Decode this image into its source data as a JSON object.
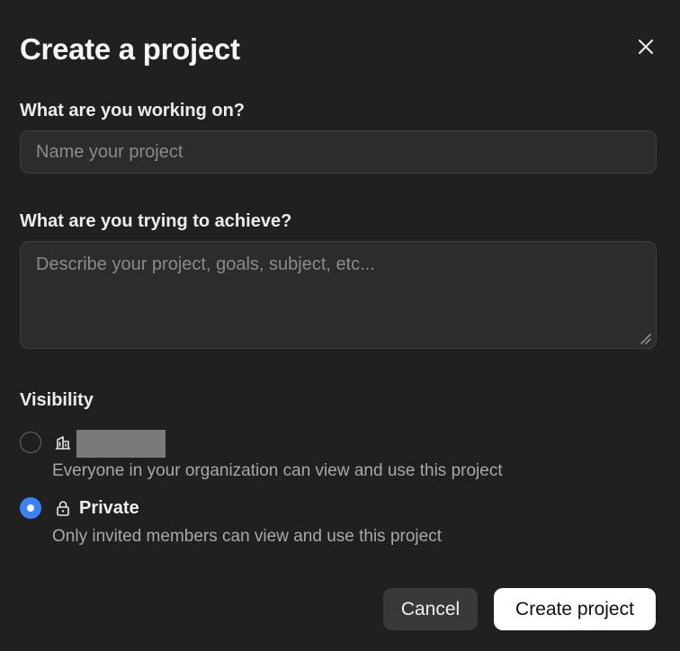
{
  "dialog": {
    "title": "Create a project",
    "close_icon": "close-icon"
  },
  "form": {
    "name": {
      "label": "What are you working on?",
      "placeholder": "Name your project",
      "value": ""
    },
    "goal": {
      "label": "What are you trying to achieve?",
      "placeholder": "Describe your project, goals, subject, etc...",
      "value": ""
    }
  },
  "visibility": {
    "label": "Visibility",
    "options": [
      {
        "icon": "building-icon",
        "title": "",
        "title_redacted": true,
        "description": "Everyone in your organization can view and use this project",
        "selected": false
      },
      {
        "icon": "lock-icon",
        "title": "Private",
        "description": "Only invited members can view and use this project",
        "selected": true
      }
    ]
  },
  "actions": {
    "cancel_label": "Cancel",
    "create_label": "Create project"
  },
  "colors": {
    "background": "#202020",
    "accent": "#3b82f6",
    "input_bg": "#2c2c2c",
    "primary_button_bg": "#ffffff"
  }
}
